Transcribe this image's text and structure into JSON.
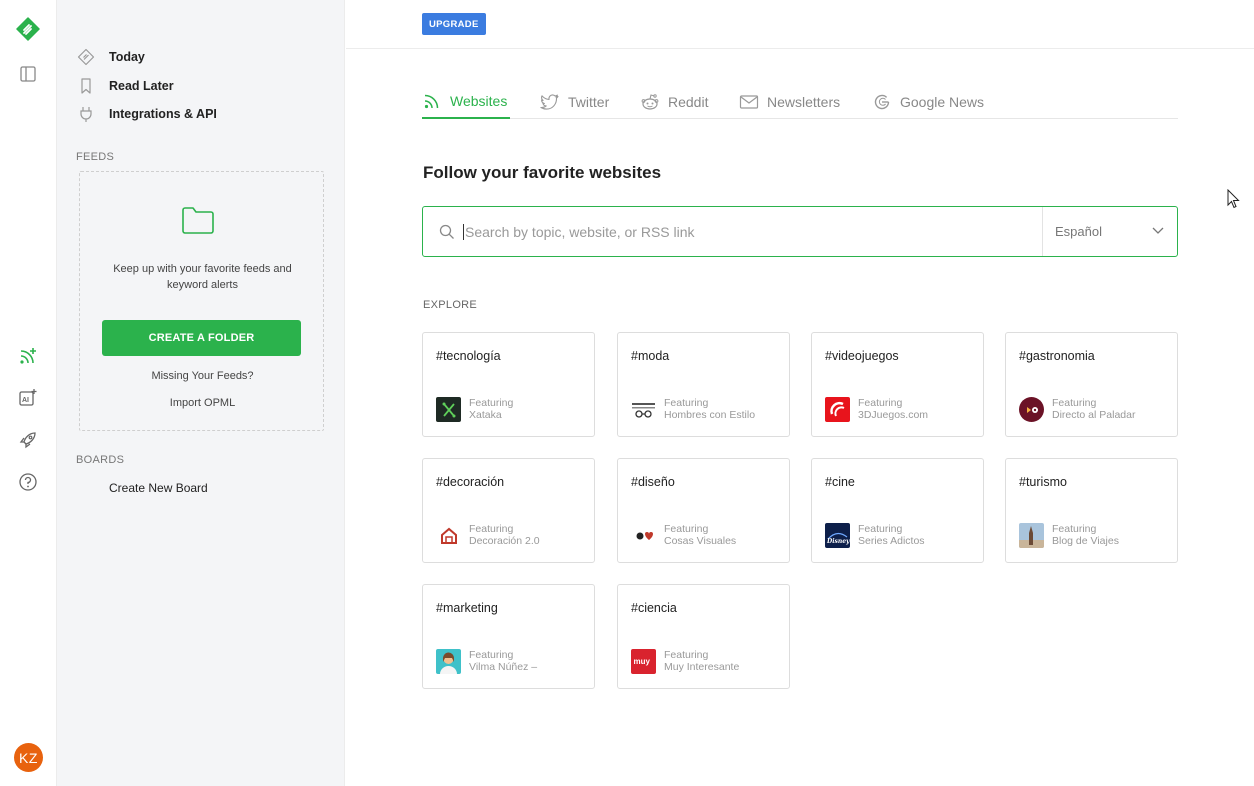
{
  "rail": {
    "avatar_initials": "KZ",
    "icons": [
      "feedly-logo-icon",
      "toggle-sidebar-icon",
      "add-feed-icon",
      "ai-add-icon",
      "rocket-icon",
      "help-icon"
    ]
  },
  "sidebar": {
    "nav": [
      {
        "label": "Today",
        "icon": "today-icon"
      },
      {
        "label": "Read Later",
        "icon": "bookmark-icon"
      },
      {
        "label": "Integrations & API",
        "icon": "plug-icon"
      }
    ],
    "feeds_label": "FEEDS",
    "feeds_description": "Keep up with your favorite feeds and keyword alerts",
    "create_folder_label": "CREATE A FOLDER",
    "missing_feeds_label": "Missing Your Feeds?",
    "import_opml_label": "Import OPML",
    "boards_label": "BOARDS",
    "create_board_label": "Create New Board"
  },
  "topbar": {
    "upgrade_label": "UPGRADE"
  },
  "tabs": [
    {
      "label": "Websites",
      "icon": "rss-icon",
      "active": true
    },
    {
      "label": "Twitter",
      "icon": "twitter-icon",
      "active": false
    },
    {
      "label": "Reddit",
      "icon": "reddit-icon",
      "active": false
    },
    {
      "label": "Newsletters",
      "icon": "mail-icon",
      "active": false
    },
    {
      "label": "Google News",
      "icon": "google-icon",
      "active": false
    }
  ],
  "main": {
    "heading": "Follow your favorite websites",
    "search_placeholder": "Search by topic, website, or RSS link",
    "language": "Español",
    "explore_label": "EXPLORE"
  },
  "explore": [
    {
      "tag": "#tecnología",
      "featuring": "Featuring",
      "site": "Xataka",
      "logo_bg": "#1e2a24",
      "logo_fg": "#5fcf5a"
    },
    {
      "tag": "#moda",
      "featuring": "Featuring",
      "site": "Hombres con Estilo",
      "logo_bg": "#ffffff",
      "logo_fg": "#333333"
    },
    {
      "tag": "#videojuegos",
      "featuring": "Featuring",
      "site": "3DJuegos.com",
      "logo_bg": "#e8141c",
      "logo_fg": "#ffffff"
    },
    {
      "tag": "#gastronomia",
      "featuring": "Featuring",
      "site": "Directo al Paladar",
      "logo_bg": "#6b1226",
      "logo_fg": "#ffffff"
    },
    {
      "tag": "#decoración",
      "featuring": "Featuring",
      "site": "Decoración 2.0",
      "logo_bg": "#ffffff",
      "logo_fg": "#c0392b"
    },
    {
      "tag": "#diseño",
      "featuring": "Featuring",
      "site": "Cosas Visuales",
      "logo_bg": "#ffffff",
      "logo_fg": "#c0392b"
    },
    {
      "tag": "#cine",
      "featuring": "Featuring",
      "site": "Series Adictos",
      "logo_bg": "#0d1f4a",
      "logo_fg": "#ffffff"
    },
    {
      "tag": "#turismo",
      "featuring": "Featuring",
      "site": "Blog de Viajes",
      "logo_bg": "#a9c4dc",
      "logo_fg": "#5a3a2a"
    },
    {
      "tag": "#marketing",
      "featuring": "Featuring",
      "site": "Vilma Núñez –",
      "logo_bg": "#3fc1c9",
      "logo_fg": "#f0c090"
    },
    {
      "tag": "#ciencia",
      "featuring": "Featuring",
      "site": "Muy Interesante",
      "logo_bg": "#d9232e",
      "logo_fg": "#ffffff"
    }
  ],
  "colors": {
    "accent": "#2bb24c",
    "upgrade": "#3b7ce0",
    "avatar": "#e8620e"
  }
}
